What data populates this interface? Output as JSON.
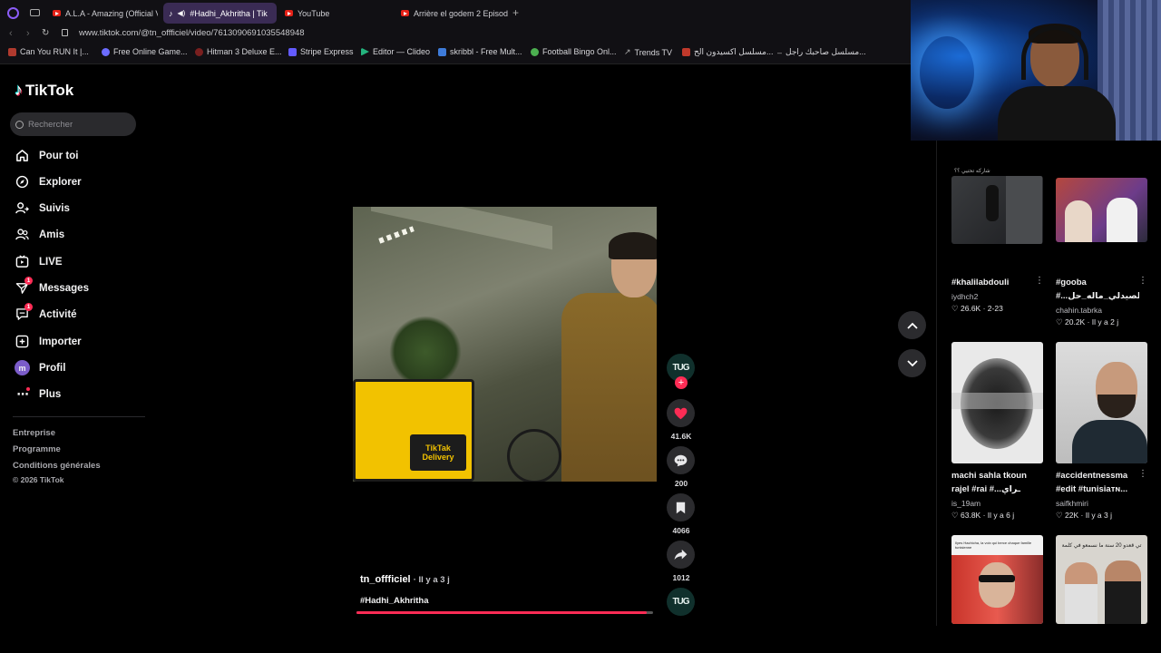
{
  "browser": {
    "tabs": [
      {
        "label": "A.L.A - Amazing (Official V"
      },
      {
        "label": "#Hadhi_Akhritha | Tik"
      },
      {
        "label": "YouTube"
      },
      {
        "label": "Arrière el godem 2 Episod"
      }
    ],
    "url": "www.tiktok.com/@tn_offficiel/video/7613090691035548948",
    "bookmarks": [
      {
        "label": "Can You RUN It |..."
      },
      {
        "label": "Free Online Game..."
      },
      {
        "label": "Hitman 3 Deluxe E..."
      },
      {
        "label": "Stripe Express"
      },
      {
        "label": "Editor — Clideo"
      },
      {
        "label": "skribbl - Free Mult..."
      },
      {
        "label": "Football Bingo Onl..."
      },
      {
        "label": "Trends TV"
      },
      {
        "label": "مسلسل اكسيدون الح..."
      },
      {
        "label": "مسلسل صاحبك راجل..."
      }
    ]
  },
  "sidebar": {
    "logo": "TikTok",
    "search_placeholder": "Rechercher",
    "items": [
      {
        "label": "Pour toi"
      },
      {
        "label": "Explorer"
      },
      {
        "label": "Suivis"
      },
      {
        "label": "Amis"
      },
      {
        "label": "LIVE"
      },
      {
        "label": "Messages",
        "badge": "1"
      },
      {
        "label": "Activité",
        "badge": "1"
      },
      {
        "label": "Importer"
      },
      {
        "label": "Profil",
        "avatar": "m"
      },
      {
        "label": "Plus"
      }
    ],
    "footer": [
      "Entreprise",
      "Programme",
      "Conditions générales",
      "© 2026 TikTok"
    ]
  },
  "video": {
    "author": "tn_offficiel",
    "time": "Il y a 3 j",
    "hashtag": "#Hadhi_Akhritha",
    "box_text": "TikTak",
    "box_sub": "Delivery",
    "avatar_text": "TUG",
    "likes": "41.6K",
    "comments": "200",
    "saves": "4066",
    "shares": "1012",
    "progress": 0.98
  },
  "right": {
    "top_caption": "شاركه تحتيي ؟؟",
    "cards": [
      {
        "title": "#khalilabdouli",
        "author": "iydhch2",
        "likes": "26.6K",
        "time": "2-23"
      },
      {
        "title": "#gooba",
        "title2": "#...عجب_الصيدلي_ماله_حل",
        "author": "chahin.tabrka",
        "likes": "20.2K",
        "time": "Il y a 2 j"
      },
      {
        "title": "machi sahla tkoun",
        "title2": "rajel #rai #...ـراي",
        "author": "is_19am",
        "likes": "63.8K",
        "time": "Il y a 6 j"
      },
      {
        "title": "#accidentnessma",
        "title2": "#edit #tunisiaᴛɴ...",
        "author": "saifkhmiri",
        "likes": "22K",
        "time": "Il y a 3 j"
      }
    ],
    "bottom_caption_1": "Ilyes Hachicha, la voix qui berce chaque famille tunisienne",
    "bottom_caption_2": "تي قعدو 20 سنة ما نسمعو في كلمة"
  },
  "colors": {
    "accent": "#fe2c55",
    "tab_active": "#3a2b54",
    "panel": "#2b2b2e"
  }
}
